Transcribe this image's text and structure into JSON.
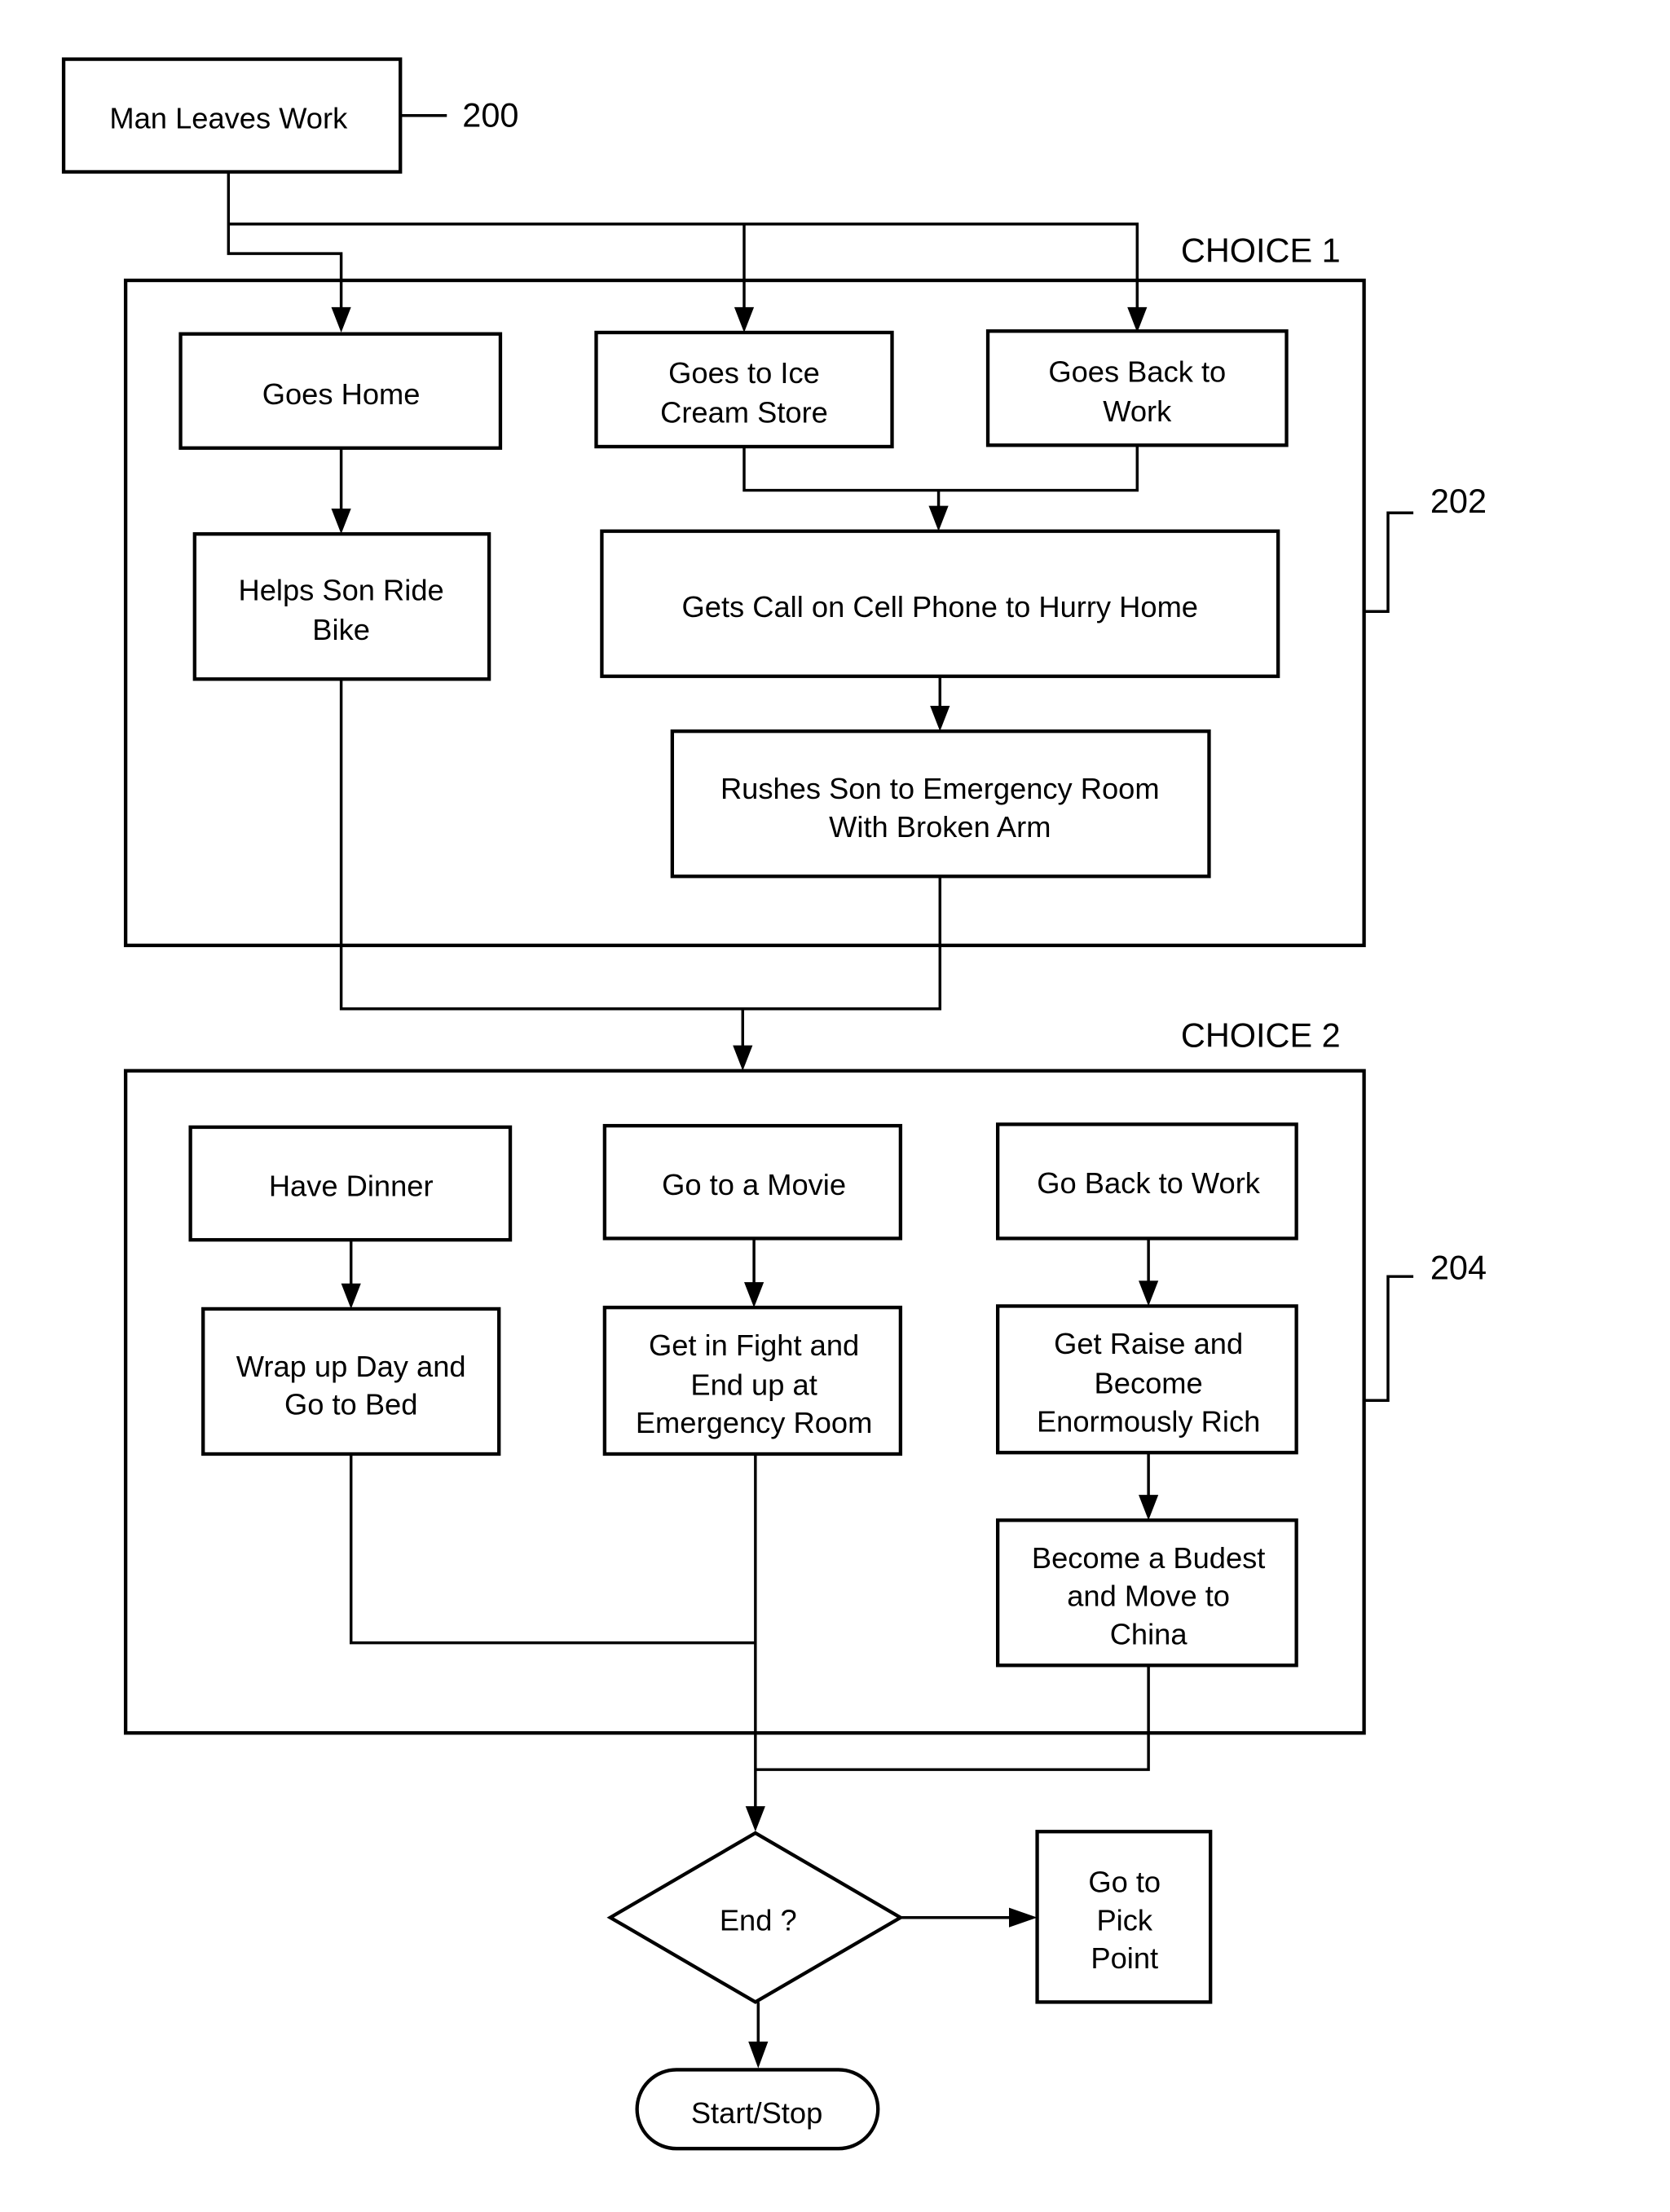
{
  "diagram": {
    "references": {
      "start": "200",
      "choice1_group": "202",
      "choice2_group": "204"
    },
    "choice1_label": "CHOICE 1",
    "choice2_label": "CHOICE 2",
    "nodes": {
      "man_leaves_work": [
        "Man Leaves Work"
      ],
      "goes_home": [
        "Goes Home"
      ],
      "goes_ice_cream": [
        "Goes to Ice",
        "Cream Store"
      ],
      "goes_back_work": [
        "Goes Back to",
        "Work"
      ],
      "helps_son": [
        "Helps Son Ride",
        "Bike"
      ],
      "gets_call": [
        "Gets Call on Cell Phone to Hurry Home"
      ],
      "rushes_son": [
        "Rushes Son to Emergency Room",
        "With Broken Arm"
      ],
      "have_dinner": [
        "Have Dinner"
      ],
      "go_movie": [
        "Go to a Movie"
      ],
      "go_back_work2": [
        "Go Back to Work"
      ],
      "wrap_up": [
        "Wrap up Day and",
        "Go to Bed"
      ],
      "get_fight": [
        "Get in Fight and",
        "End up at",
        "Emergency Room"
      ],
      "get_raise": [
        "Get Raise and",
        "Become",
        "Enormously Rich"
      ],
      "become_budest": [
        "Become a Budest",
        "and Move to",
        "China"
      ],
      "end_decision": [
        "End ?"
      ],
      "go_pick_point": [
        "Go to",
        "Pick",
        "Point"
      ],
      "start_stop": [
        "Start/Stop"
      ]
    }
  }
}
